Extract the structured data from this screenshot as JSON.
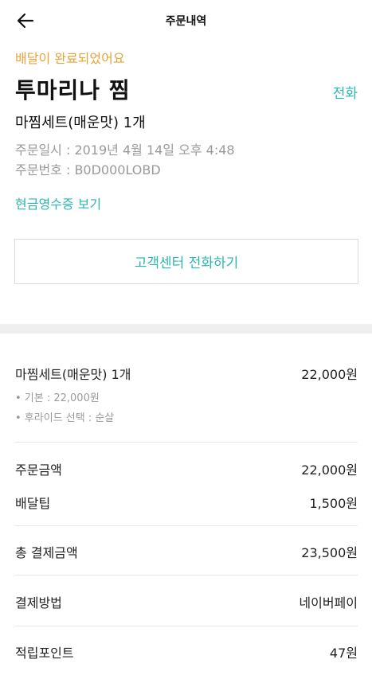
{
  "header": {
    "title": "주문내역"
  },
  "order": {
    "status": "배달이 완료되었어요",
    "store_name": "투마리나 찜",
    "call_label": "전화",
    "menu_summary": "마찜세트(매운맛) 1개",
    "order_date": "주문일시 : 2019년 4월 14일 오후 4:48",
    "order_number": "주문번호 : B0D000LOBD",
    "receipt_link": "현금영수증 보기",
    "cs_button": "고객센터 전화하기"
  },
  "items": [
    {
      "name": "마찜세트(매운맛) 1개",
      "price": "22,000원",
      "options": [
        "• 기본 : 22,000원",
        "• 후라이드 선택 : 순살"
      ]
    }
  ],
  "payment": {
    "order_amount_label": "주문금액",
    "order_amount": "22,000원",
    "delivery_tip_label": "배달팁",
    "delivery_tip": "1,500원",
    "total_label": "총 결제금액",
    "total": "23,500원",
    "method_label": "결제방법",
    "method": "네이버페이",
    "points_label": "적립포인트",
    "points": "47원"
  },
  "colors": {
    "accent": "#2db6b0",
    "status": "#e8a237"
  },
  "icons": {
    "back": "arrow-left-icon"
  }
}
